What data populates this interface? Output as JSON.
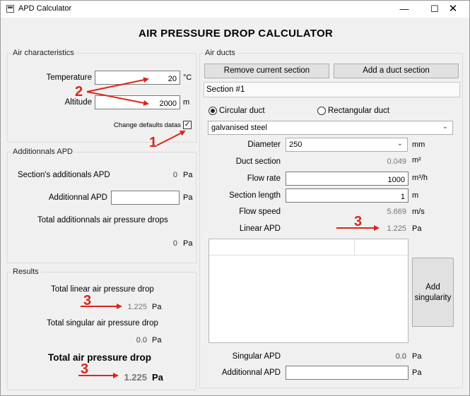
{
  "window": {
    "title": "APD Calculator",
    "minimize": "—",
    "maximize": "☐",
    "close": "✕"
  },
  "heading": "AIR PRESSURE DROP CALCULATOR",
  "air": {
    "title": "Air characteristics",
    "temperature_label": "Temperature",
    "temperature_value": "20",
    "temperature_unit": "°C",
    "altitude_label": "Altitude",
    "altitude_value": "2000",
    "altitude_unit": "m",
    "change_defaults_label": "Change defaults datas",
    "change_defaults_checked": "✓"
  },
  "additional": {
    "title": "Additionnals APD",
    "section_label": "Section's additionals APD",
    "section_value": "0",
    "section_unit": "Pa",
    "input_label": "Additionnal APD",
    "input_value": "",
    "input_unit": "Pa",
    "total_label": "Total additionnals air pressure drops",
    "total_value": "0",
    "total_unit": "Pa"
  },
  "results": {
    "title": "Results",
    "linear_label": "Total linear air pressure drop",
    "linear_value": "1.225",
    "linear_unit": "Pa",
    "singular_label": "Total singular air pressure drop",
    "singular_value": "0.0",
    "singular_unit": "Pa",
    "total_label": "Total air pressure drop",
    "total_value": "1.225",
    "total_unit": "Pa"
  },
  "ducts": {
    "title": "Air ducts",
    "remove_button": "Remove current section",
    "add_button": "Add a duct section",
    "section_tab": "Section #1",
    "circular_label": "Circular duct",
    "rectangular_label": "Rectangular duct",
    "material": "galvanised steel",
    "diameter_label": "Diameter",
    "diameter_value": "250",
    "diameter_unit": "mm",
    "duct_section_label": "Duct section",
    "duct_section_value": "0.049",
    "duct_section_unit": "m²",
    "flow_rate_label": "Flow rate",
    "flow_rate_value": "1000",
    "flow_rate_unit": "m³/h",
    "section_length_label": "Section length",
    "section_length_value": "1",
    "section_length_unit": "m",
    "flow_speed_label": "Flow speed",
    "flow_speed_value": "5.669",
    "flow_speed_unit": "m/s",
    "linear_apd_label": "Linear APD",
    "linear_apd_value": "1.225",
    "linear_apd_unit": "Pa",
    "add_singularity_button": "Add singularity",
    "singular_apd_label": "Singular APD",
    "singular_apd_value": "0.0",
    "singular_apd_unit": "Pa",
    "additional_apd_label": "Additionnal APD",
    "additional_apd_value": "",
    "additional_apd_unit": "Pa"
  },
  "annotations": {
    "marker_1": "1",
    "marker_2": "2",
    "marker_3_duct": "3",
    "marker_3_linear": "3",
    "marker_3_total": "3",
    "color": "#d9261c"
  }
}
